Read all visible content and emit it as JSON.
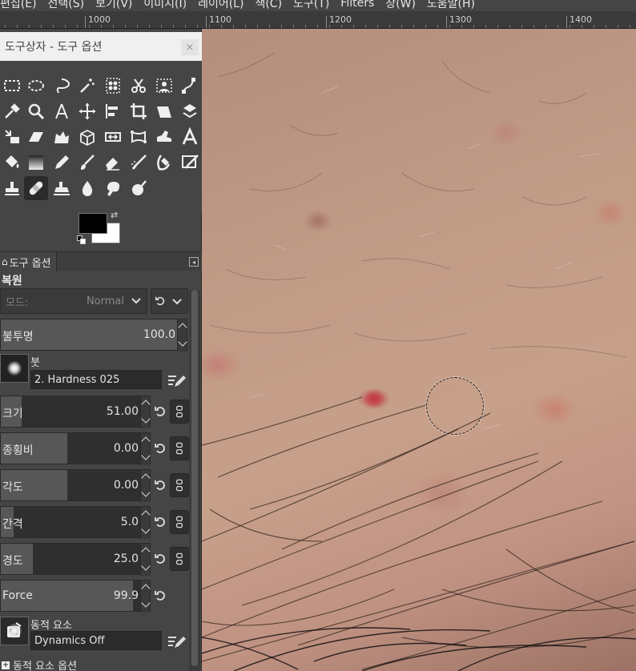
{
  "menu": [
    "편집(E)",
    "선택(S)",
    "보기(V)",
    "이미지(I)",
    "레이어(L)",
    "색(C)",
    "도구(T)",
    "Filters",
    "창(W)",
    "도움말(H)"
  ],
  "ruler": {
    "labels": [
      "1000",
      "1100",
      "1200",
      "1300",
      "1400"
    ]
  },
  "dock": {
    "title": "도구상자 - 도구 옵션",
    "close": "×"
  },
  "colors": {
    "foreground": "#000000",
    "background": "#ffffff"
  },
  "options": {
    "tab_label": "도구 옵션",
    "tool_name": "복원",
    "mode_label": "모드:",
    "mode_value": "Normal",
    "opacity": {
      "label": "불투명",
      "value": "100.0"
    },
    "brush": {
      "label": "붓",
      "name": "2. Hardness 025"
    },
    "size": {
      "label": "크기",
      "value": "51.00",
      "fraction": 0.15
    },
    "aspect": {
      "label": "종횡비",
      "value": "0.00",
      "fraction": 0.47
    },
    "angle": {
      "label": "각도",
      "value": "0.00",
      "fraction": 0.47
    },
    "spacing": {
      "label": "간격",
      "value": "5.0",
      "fraction": 0.09
    },
    "hardness": {
      "label": "경도",
      "value": "25.0",
      "fraction": 0.23
    },
    "force": {
      "label": "Force",
      "value": "99.9",
      "fraction": 0.94
    },
    "dynamics": {
      "label": "동적 요소",
      "name": "Dynamics Off"
    },
    "dynamics_options": "동적 요소 옵션"
  }
}
